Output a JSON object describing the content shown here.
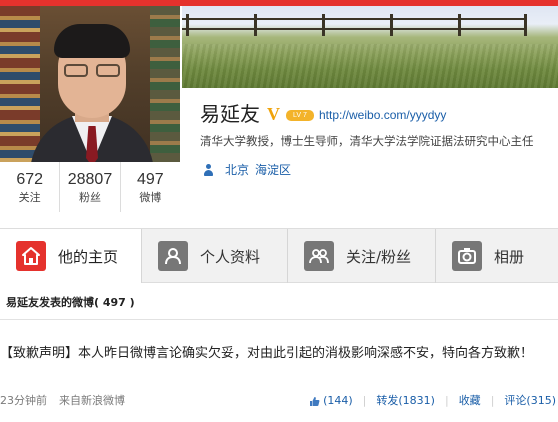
{
  "profile": {
    "name": "易延友",
    "v_badge": "V",
    "level_badge": "LV 7",
    "url": "http://weibo.com/yyydyy",
    "bio": "清华大学教授，博士生导师，清华大学法学院证据法研究中心主任",
    "location": {
      "province": "北京",
      "district": "海淀区"
    },
    "stats": [
      {
        "number": "672",
        "label": "关注"
      },
      {
        "number": "28807",
        "label": "粉丝"
      },
      {
        "number": "497",
        "label": "微博"
      }
    ]
  },
  "tabs": [
    {
      "label": "他的主页",
      "icon": "home-icon",
      "active": true
    },
    {
      "label": "个人资料",
      "icon": "person-icon",
      "active": false
    },
    {
      "label": "关注/粉丝",
      "icon": "people-icon",
      "active": false
    },
    {
      "label": "相册",
      "icon": "camera-icon",
      "active": false
    }
  ],
  "feed": {
    "title": "易延友发表的微博",
    "count": "( 497 )"
  },
  "post": {
    "text": "【致歉声明】本人昨日微博言论确实欠妥，对由此引起的消极影响深感不安，特向各方致歉！",
    "time": "23分钟前",
    "source": "来自新浪微博",
    "likes": "(144)",
    "repost": "转发(1831)",
    "favorite": "收藏",
    "comment": "评论(315)"
  },
  "colors": {
    "brand_red": "#e5322d",
    "link_blue": "#1a5ea8",
    "v_gold": "#f0a30a"
  }
}
